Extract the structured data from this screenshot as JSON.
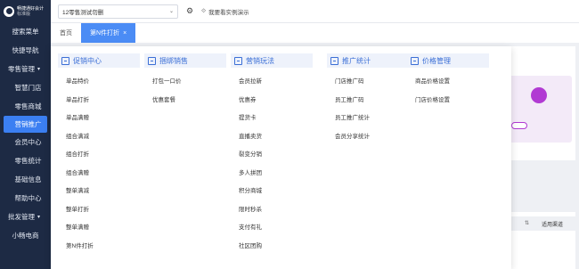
{
  "brand": {
    "line1": "畅捷通好会计",
    "line2": "标准版"
  },
  "sidebar": {
    "items": [
      {
        "label": "搜索菜单",
        "kind": "top"
      },
      {
        "label": "快捷导航",
        "kind": "top"
      },
      {
        "label": "零售管理",
        "kind": "group",
        "caret": "▾"
      },
      {
        "label": "智慧门店",
        "kind": "sub"
      },
      {
        "label": "零售商城",
        "kind": "sub"
      },
      {
        "label": "营销推广",
        "kind": "sub",
        "active": true
      },
      {
        "label": "会员中心",
        "kind": "sub"
      },
      {
        "label": "零售统计",
        "kind": "sub"
      },
      {
        "label": "基础信息",
        "kind": "sub"
      },
      {
        "label": "帮助中心",
        "kind": "sub"
      },
      {
        "label": "批发管理",
        "kind": "group",
        "caret": "▾"
      },
      {
        "label": "小畅电商",
        "kind": "top"
      }
    ]
  },
  "topbar": {
    "store_value": "12零售测试勿删",
    "store_chevron": "⌄",
    "settings_icon": "⚙",
    "demo_icon": "⟐",
    "demo_label": "我要看实例演示"
  },
  "tabs": [
    {
      "label": "首页",
      "active": false
    },
    {
      "label": "第N件打折",
      "active": true,
      "close": "×"
    }
  ],
  "background": {
    "table_sort": "⇅",
    "table_col": "适用渠道"
  },
  "mega_menu": {
    "columns": [
      {
        "title": "促销中心",
        "items": [
          "单品特价",
          "单品打折",
          "单品满赠",
          "组合满减",
          "组合打折",
          "组合满赠",
          "整单满减",
          "整单打折",
          "整单满赠",
          "第N件打折"
        ]
      },
      {
        "title": "捆绑销售",
        "items": [
          "打包一口价",
          "优惠套餐"
        ]
      },
      {
        "title": "营销玩法",
        "items": [
          "会员拉新",
          "优惠券",
          "提货卡",
          "直播卖货",
          "裂变分销",
          "多人拼团",
          "积分商城",
          "限时秒杀",
          "支付有礼",
          "社区团购"
        ]
      },
      {
        "title": "推广统计",
        "items": [
          "门店推广码",
          "员工推广码",
          "员工推广统计",
          "会员分享统计"
        ]
      },
      {
        "title": "价格管理",
        "items": [
          "商品价格设置",
          "门店价格设置"
        ]
      }
    ]
  },
  "colors": {
    "sidebar_bg": "#1d2a44",
    "accent": "#3b7ff2",
    "menu_head_text": "#3b6fd6",
    "promo_purple": "#b13ad3"
  }
}
